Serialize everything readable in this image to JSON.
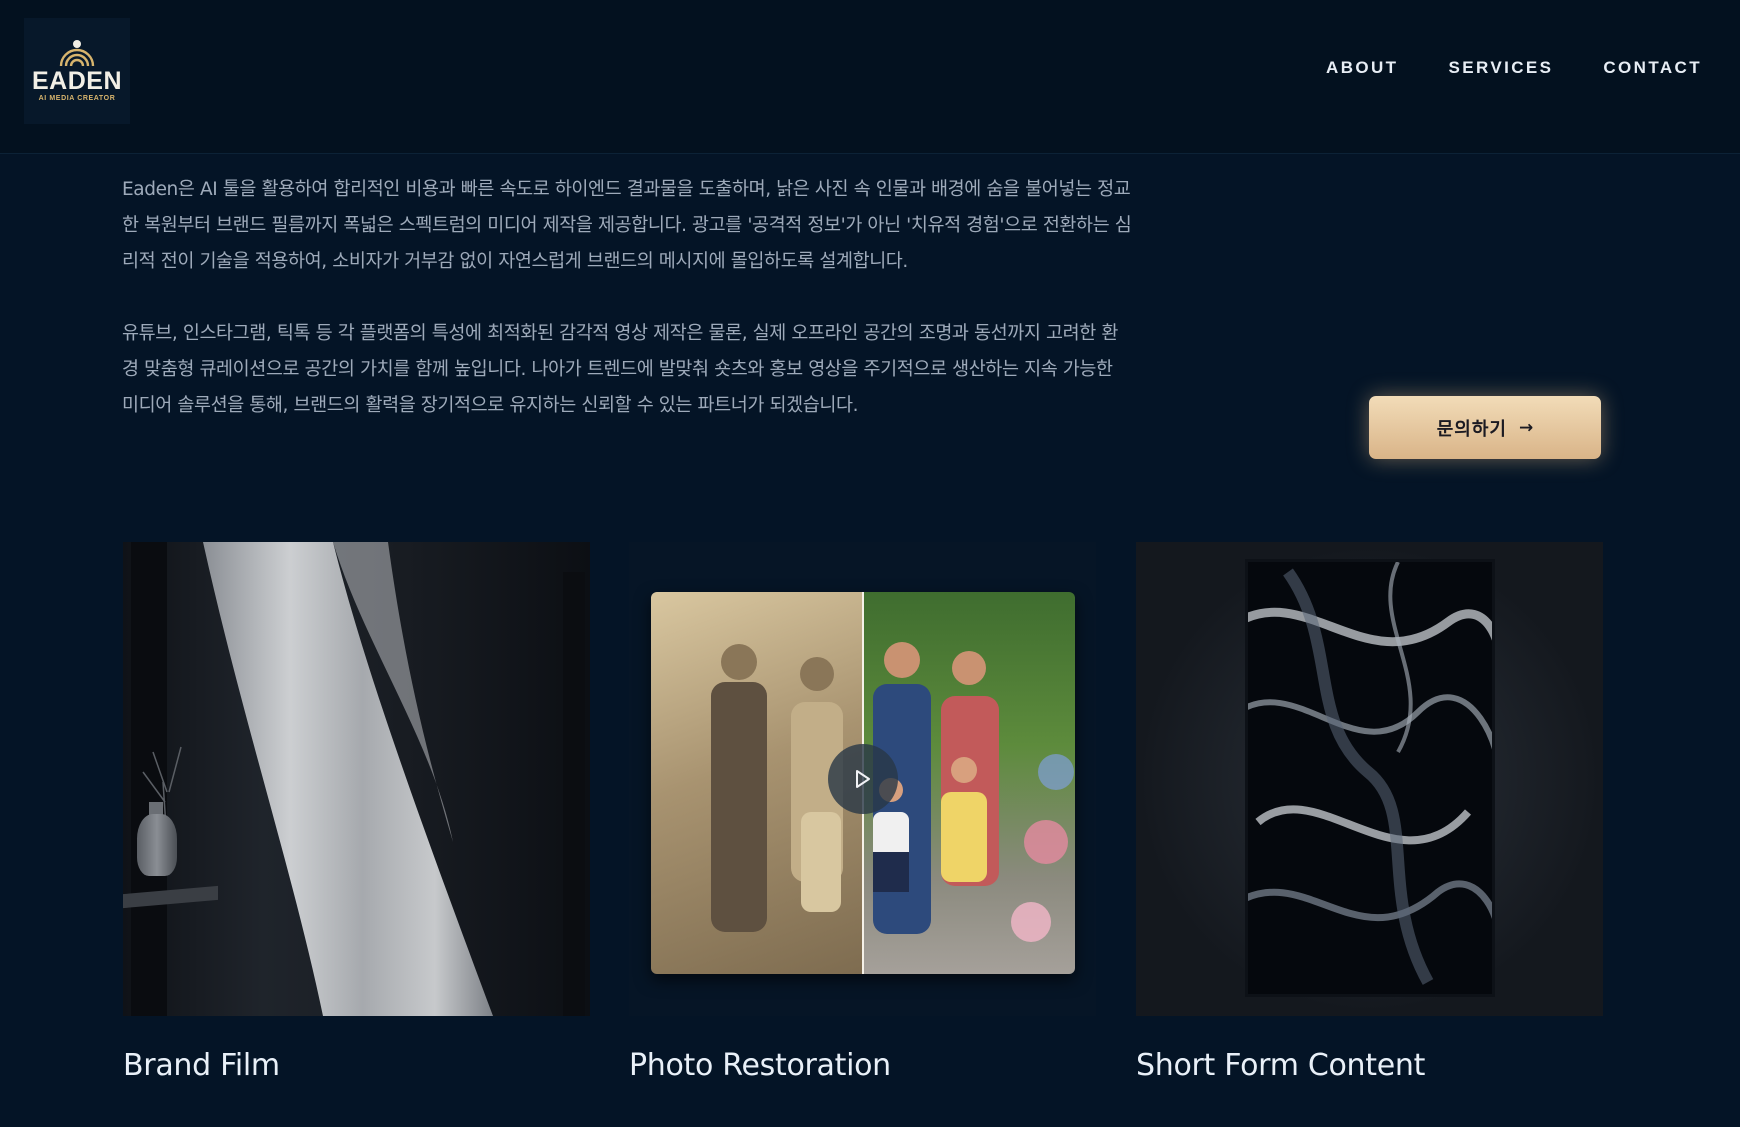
{
  "header": {
    "logo": {
      "word": "EADEN",
      "sub": "AI MEDIA CREATOR",
      "icon": "arch-logo-icon"
    },
    "nav": [
      {
        "label": "ABOUT"
      },
      {
        "label": "SERVICES"
      },
      {
        "label": "CONTACT"
      }
    ]
  },
  "intro": {
    "paragraphs": [
      "Eaden은 AI 툴을 활용하여 합리적인 비용과 빠른 속도로 하이엔드 결과물을 도출하며, 낡은 사진 속 인물과 배경에 숨을 불어넣는 정교한 복원부터 브랜드 필름까지 폭넓은 스펙트럼의 미디어 제작을 제공합니다. 광고를 '공격적 정보'가 아닌 '치유적 경험'으로 전환하는 심리적 전이 기술을 적용하여, 소비자가 거부감 없이 자연스럽게 브랜드의 메시지에 몰입하도록 설계합니다.",
      "유튜브, 인스타그램, 틱톡 등 각 플랫폼의 특성에 최적화된 감각적 영상 제작은 물론, 실제 오프라인 공간의 조명과 동선까지 고려한 환경 맞춤형 큐레이션으로 공간의 가치를 함께 높입니다. 나아가 트렌드에 발맞춰 숏츠와 홍보 영상을 주기적으로 생산하는 지속 가능한 미디어 솔루션을 통해, 브랜드의 활력을 장기적으로 유지하는 신뢰할 수 있는 파트너가 되겠습니다."
    ]
  },
  "cta": {
    "label": "문의하기",
    "arrow": "→",
    "icon": "arrow-right-icon"
  },
  "cards": [
    {
      "title": "Brand Film"
    },
    {
      "title": "Photo Restoration",
      "icon": "play-icon"
    },
    {
      "title": "Short Form Content"
    }
  ],
  "colors": {
    "background": "#041426",
    "header": "#03111f",
    "accent_gold": "#d9b488",
    "text": "#9eaaba"
  }
}
